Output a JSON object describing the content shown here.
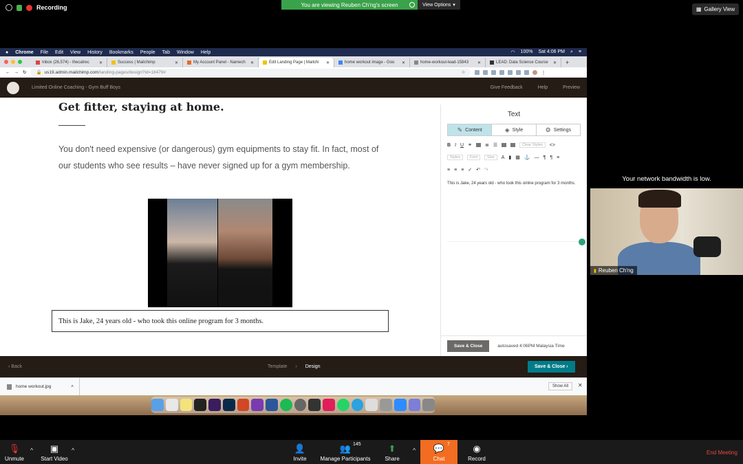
{
  "zoom_top": {
    "recording_label": "Recording",
    "viewing_banner": "You are viewing Reuben Ch'ng's screen",
    "view_options": "View Options",
    "gallery_view": "Gallery View"
  },
  "mac_menu": {
    "items": [
      "Chrome",
      "File",
      "Edit",
      "View",
      "History",
      "Bookmarks",
      "People",
      "Tab",
      "Window",
      "Help"
    ],
    "battery": "100%",
    "clock": "Sat 4:06 PM"
  },
  "browser": {
    "tabs": [
      {
        "label": "Inbox (26,574) - thecatrec"
      },
      {
        "label": "Success | Mailchimp"
      },
      {
        "label": "My Account Panel - Namech"
      },
      {
        "label": "Edit Landing Page | Mailchi"
      },
      {
        "label": "home workout image - Goo"
      },
      {
        "label": "home-workout-lead-15843"
      },
      {
        "label": "LEAD: Data Science Course"
      }
    ],
    "url_domain": "us19.admin.mailchimp.com",
    "url_path": "/landing-pages/design?id=18479#"
  },
  "mailchimp": {
    "page_name": "Limited Online Coaching - Gym Buff Boys",
    "give_feedback": "Give Feedback",
    "help": "Help",
    "preview": "Preview"
  },
  "content": {
    "heading": "Get fitter, staying at home.",
    "paragraph": "You don't need expensive (or dangerous) gym equipments to stay fit. In fact, most of our students who see results – have never signed up for a gym membership.",
    "caption": "This is Jake, 24 years old - who took this online program for 3 months."
  },
  "panel": {
    "title": "Text",
    "tabs": [
      "Content",
      "Style",
      "Settings"
    ],
    "toolbar": {
      "clear_styles": "Clear Styles",
      "styles": "Styles",
      "font": "Font",
      "size": "Size"
    },
    "editor_text": "This is Jake, 24 years old - who took this online program for 3 months.",
    "save_close": "Save & Close",
    "autosave": "autosaved 4:06PM Malaysia Time"
  },
  "footer": {
    "back": "Back",
    "crumb_template": "Template",
    "crumb_design": "Design",
    "save_close": "Save & Close"
  },
  "downloads": {
    "file": "home workout.jpg",
    "show_all": "Show All"
  },
  "participant": {
    "bandwidth_message": "Your network bandwidth is low.",
    "name": "Reuben Ch'ng"
  },
  "zoom_bottom": {
    "unmute": "Unmute",
    "start_video": "Start Video",
    "invite": "Invite",
    "manage_participants": "Manage Participants",
    "participants_count": "145",
    "share": "Share",
    "chat": "Chat",
    "chat_badge": "7",
    "record": "Record",
    "end_meeting": "End Meeting"
  }
}
